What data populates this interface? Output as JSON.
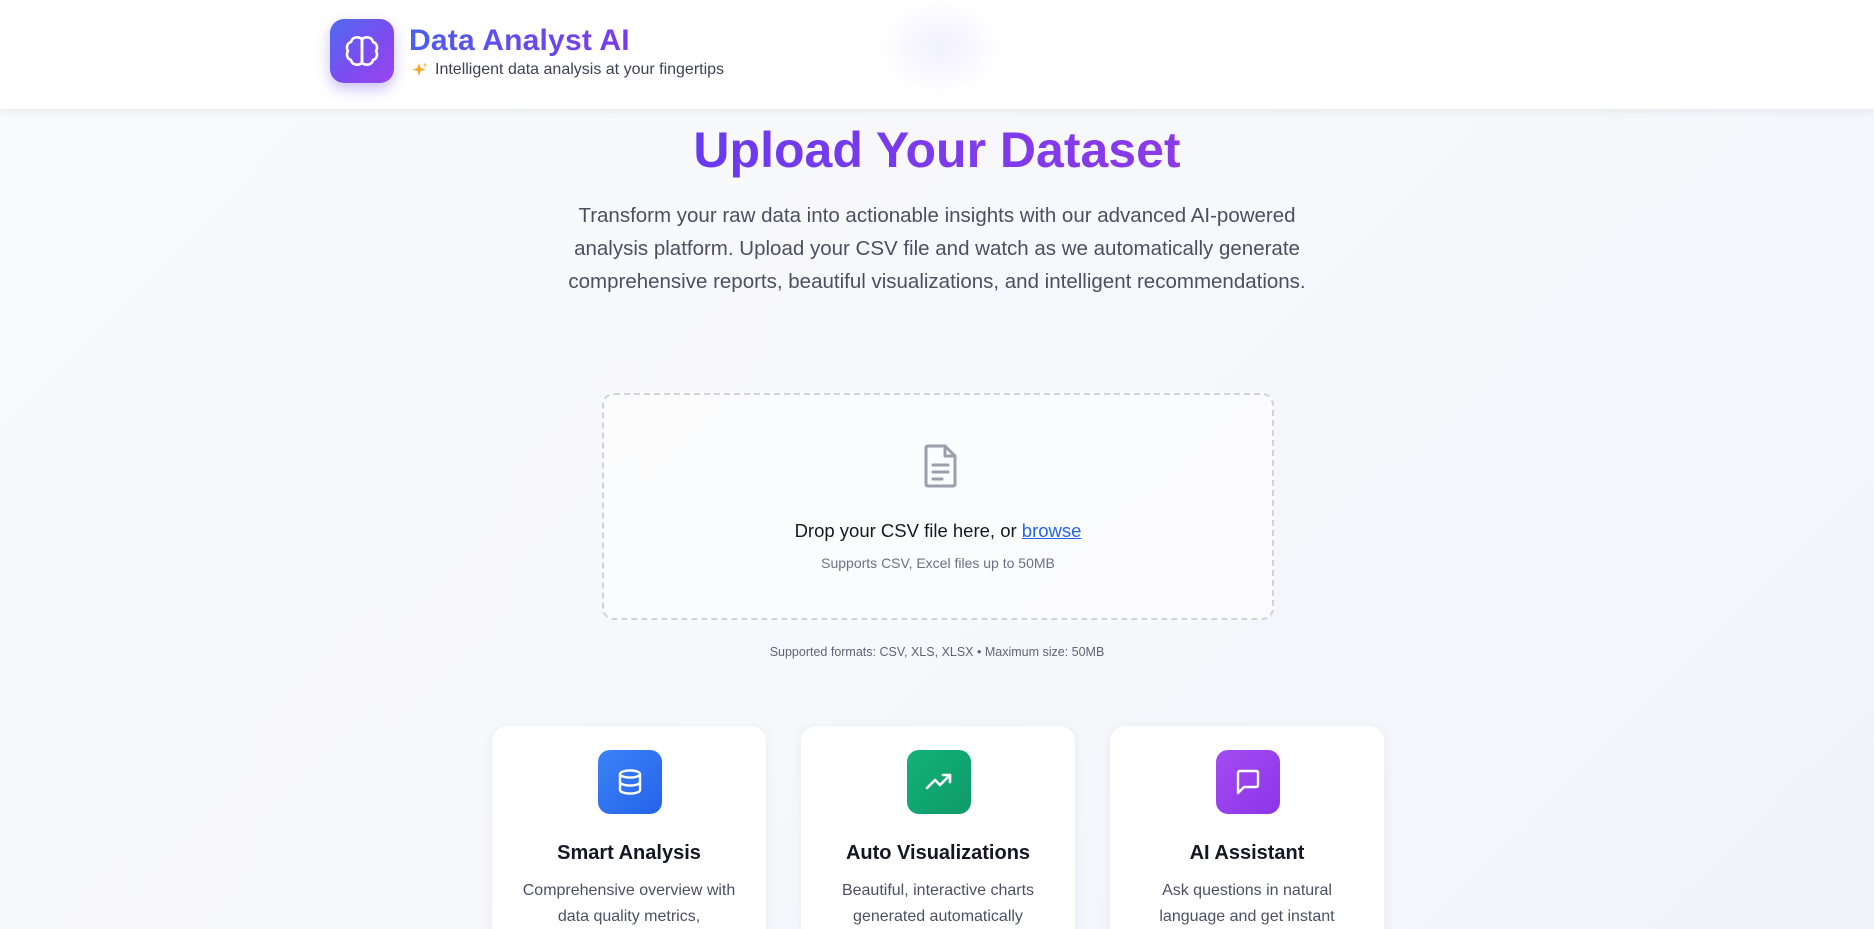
{
  "header": {
    "brand_title": "Data Analyst AI",
    "brand_subtitle": "Intelligent data analysis at your fingertips",
    "logo_icon": "brain-icon",
    "sparkle_icon": "sparkles-icon",
    "accent_gradient": [
      "#4f6cf0",
      "#9b45ee"
    ]
  },
  "hero": {
    "title": "Upload Your Dataset",
    "description": "Transform your raw data into actionable insights with our advanced AI-powered analysis platform. Upload your CSV file and watch as we automatically generate comprehensive reports, beautiful visualizations, and intelligent recommendations."
  },
  "upload": {
    "icon": "file-text-icon",
    "prompt": "Drop your CSV file here, or ",
    "browse_label": "browse",
    "supports": "Supports CSV, Excel files up to 50MB",
    "formats_note": "Supported formats: CSV, XLS, XLSX • Maximum size: 50MB",
    "link_color": "#2563eb"
  },
  "features": [
    {
      "title": "Smart Analysis",
      "description": "Comprehensive overview with data quality metrics,",
      "icon": "database-icon",
      "color": "#2f6ff0"
    },
    {
      "title": "Auto Visualizations",
      "description": "Beautiful, interactive charts generated automatically",
      "icon": "trending-up-icon",
      "color": "#10a872"
    },
    {
      "title": "AI Assistant",
      "description": "Ask questions in natural language and get instant",
      "icon": "message-square-icon",
      "color": "#9a3ff0"
    }
  ]
}
